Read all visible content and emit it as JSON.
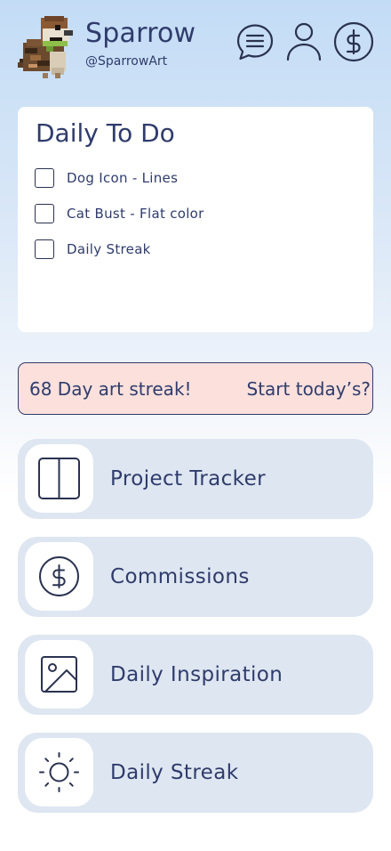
{
  "header": {
    "app_name": "Sparrow",
    "handle": "@SparrowArt",
    "avatar_icon": "sparrow-pixel-avatar",
    "icons": [
      "chat-icon",
      "profile-icon",
      "dollar-icon"
    ]
  },
  "todo": {
    "title": "Daily To Do",
    "items": [
      {
        "label": "Dog Icon - Lines",
        "checked": false
      },
      {
        "label": "Cat Bust - Flat color",
        "checked": false
      },
      {
        "label": "Daily Streak",
        "checked": false
      }
    ]
  },
  "streak_banner": {
    "text": "68 Day art streak!",
    "cta": "Start today’s?"
  },
  "nav": [
    {
      "label": "Project Tracker",
      "icon": "split-panel-icon"
    },
    {
      "label": "Commissions",
      "icon": "dollar-circle-icon"
    },
    {
      "label": "Daily Inspiration",
      "icon": "image-icon"
    },
    {
      "label": "Daily Streak",
      "icon": "sun-icon"
    }
  ],
  "colors": {
    "text": "#2f3c6c",
    "banner_bg": "#fbe0dc",
    "nav_card_bg": "#dee6f1",
    "header_gradient_top": "#c3dcf6"
  }
}
